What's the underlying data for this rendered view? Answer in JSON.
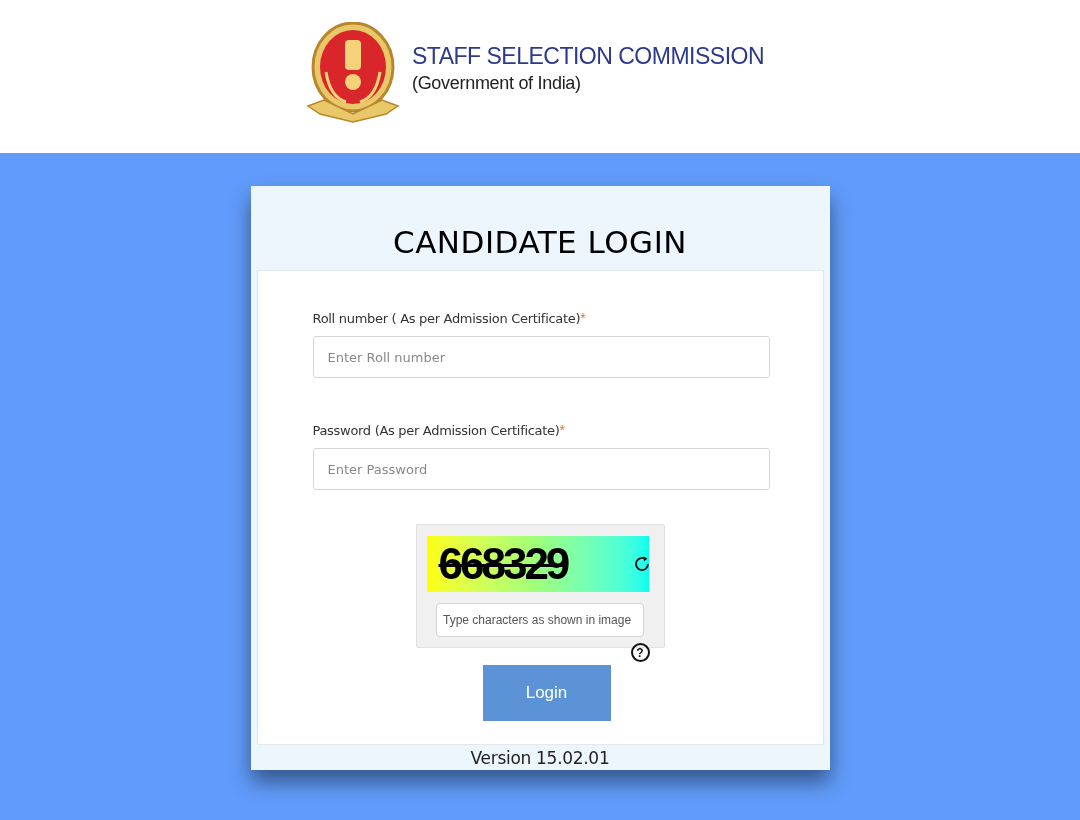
{
  "header": {
    "title": "STAFF SELECTION COMMISSION",
    "subtitle": "(Government of India)"
  },
  "login": {
    "title": "CANDIDATE LOGIN",
    "fields": [
      {
        "label": "Roll number ( As per Admission Certificate)",
        "required_mark": "*",
        "placeholder": "Enter Roll number"
      },
      {
        "label": "Password (As per Admission Certificate)",
        "required_mark": "*",
        "placeholder": "Enter Password"
      }
    ],
    "captcha": {
      "code": "668329",
      "placeholder": "Type characters as shown in image",
      "help": "?"
    },
    "button": "Login",
    "version": "Version 15.02.01"
  }
}
